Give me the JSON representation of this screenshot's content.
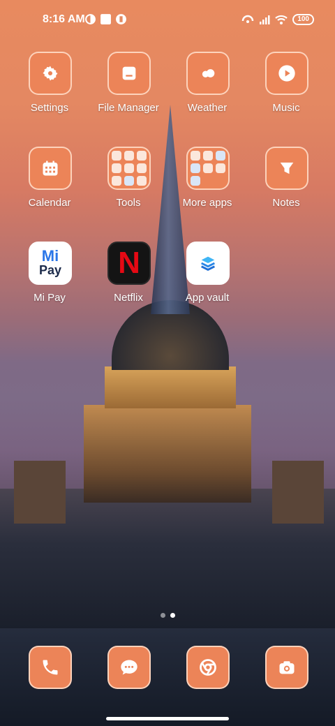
{
  "status_bar": {
    "time": "8:16 AM",
    "battery": "100"
  },
  "home_grid": {
    "apps": [
      {
        "label": "Settings",
        "icon": "gear-icon"
      },
      {
        "label": "File Manager",
        "icon": "folder-icon"
      },
      {
        "label": "Weather",
        "icon": "cloud-icon"
      },
      {
        "label": "Music",
        "icon": "play-icon"
      },
      {
        "label": "Calendar",
        "icon": "calendar-icon"
      },
      {
        "label": "Tools",
        "icon": "folder-grid-icon"
      },
      {
        "label": "More apps",
        "icon": "folder-grid-icon"
      },
      {
        "label": "Notes",
        "icon": "notes-icon"
      },
      {
        "label": "Mi Pay",
        "icon": "mi-pay-icon"
      },
      {
        "label": "Netflix",
        "icon": "netflix-icon"
      },
      {
        "label": "App vault",
        "icon": "app-vault-icon"
      }
    ]
  },
  "mipay_logo": {
    "line1": "Mi",
    "line2": "Pay"
  },
  "netflix_logo": "N",
  "dock": {
    "apps": [
      {
        "icon": "phone-icon"
      },
      {
        "icon": "messages-icon"
      },
      {
        "icon": "chrome-icon"
      },
      {
        "icon": "camera-icon"
      }
    ]
  },
  "page_indicator": {
    "count": 2,
    "active": 2
  },
  "colors": {
    "tile": "#ec8458",
    "tile_border": "#ffdcc8",
    "text": "#ffffff"
  }
}
